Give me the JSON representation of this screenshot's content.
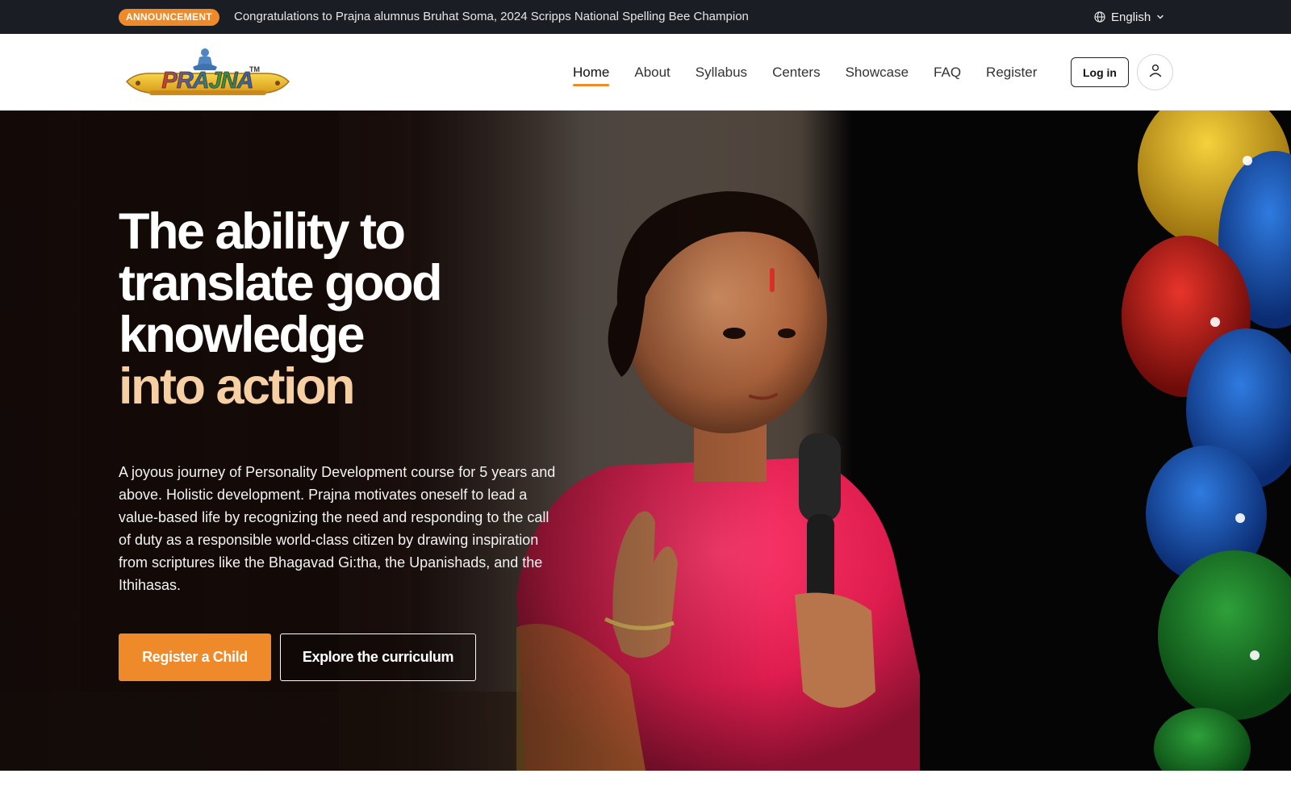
{
  "announcement": {
    "badge": "ANNOUNCEMENT",
    "text": "Congratulations to Prajna alumnus Bruhat Soma, 2024 Scripps National Spelling Bee Champion",
    "language": "English"
  },
  "header": {
    "logo_text": "PRAJNA",
    "nav": [
      "Home",
      "About",
      "Syllabus",
      "Centers",
      "Showcase",
      "FAQ",
      "Register"
    ],
    "active_nav": "Home",
    "login_label": "Log in"
  },
  "hero": {
    "headline_lines": [
      "The ability to",
      "translate good",
      "knowledge"
    ],
    "headline_accent": "into action",
    "lead": "A joyous journey of Personality Development course for 5 years and above. Holistic development. Prajna motivates oneself to lead a value-based life by recognizing the need and responding to the call of duty as a responsible world-class citizen by drawing inspiration from scriptures like the Bhagavad Gi:tha, the Upanishads, and the Ithihasas.",
    "primary_button": "Register a Child",
    "secondary_button": "Explore the curriculum"
  },
  "colors": {
    "accent": "#ef8a2b",
    "topbar_bg": "#1a1d23",
    "headline_accent": "#f6cfa2"
  },
  "icons": {
    "language": "globe-icon",
    "language_dropdown": "chevron-down-icon",
    "account": "user-icon"
  }
}
